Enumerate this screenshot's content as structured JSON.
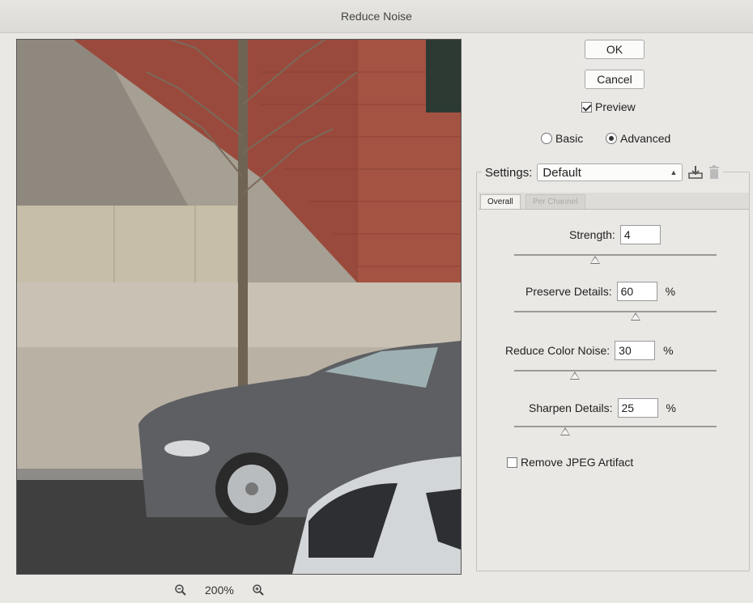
{
  "window": {
    "title": "Reduce Noise"
  },
  "buttons": {
    "ok": "OK",
    "cancel": "Cancel"
  },
  "preview_toggle": {
    "label": "Preview",
    "checked": true
  },
  "mode": {
    "basic_label": "Basic",
    "advanced_label": "Advanced",
    "selected": "Advanced"
  },
  "settings": {
    "label": "Settings:",
    "value": "Default"
  },
  "tabs": [
    {
      "label": "Overall",
      "active": true
    },
    {
      "label": "Per Channel",
      "active": false
    }
  ],
  "controls": {
    "strength": {
      "label": "Strength:",
      "value": "4",
      "unit": "",
      "level": 0.4
    },
    "preserve_details": {
      "label": "Preserve Details:",
      "value": "60",
      "unit": "%",
      "level": 0.6
    },
    "reduce_color_noise": {
      "label": "Reduce Color Noise:",
      "value": "30",
      "unit": "%",
      "level": 0.3
    },
    "sharpen_details": {
      "label": "Sharpen Details:",
      "value": "25",
      "unit": "%",
      "level": 0.25
    }
  },
  "remove_jpeg": {
    "label": "Remove JPEG Artifact",
    "checked": false
  },
  "zoom": {
    "level": "200%"
  }
}
